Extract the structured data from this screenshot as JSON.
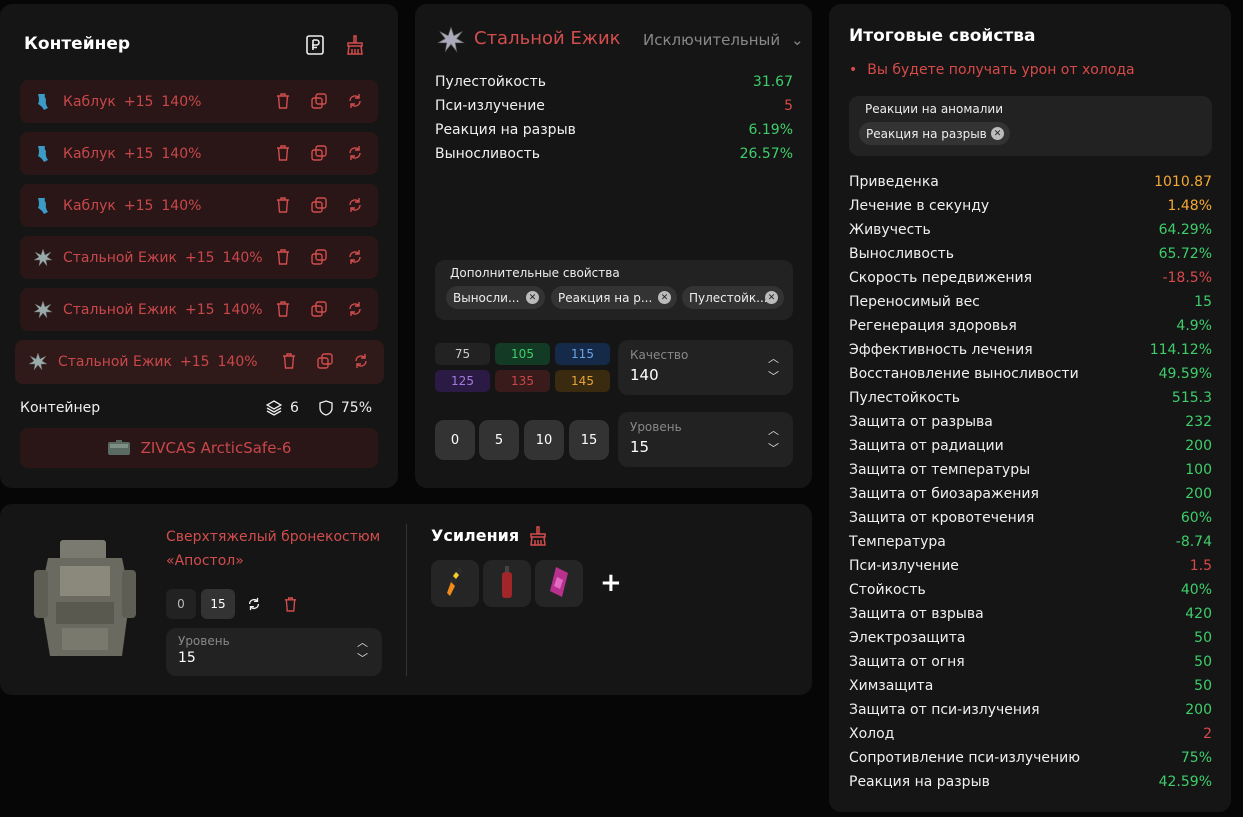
{
  "container": {
    "title": "Контейнер",
    "slots": [
      {
        "name": "Каблук",
        "level": "+15",
        "percent": "140%",
        "art": "kabluk"
      },
      {
        "name": "Каблук",
        "level": "+15",
        "percent": "140%",
        "art": "kabluk"
      },
      {
        "name": "Каблук",
        "level": "+15",
        "percent": "140%",
        "art": "kabluk"
      },
      {
        "name": "Стальной Ежик",
        "level": "+15",
        "percent": "140%",
        "art": "ezhik"
      },
      {
        "name": "Стальной Ежик",
        "level": "+15",
        "percent": "140%",
        "art": "ezhik"
      },
      {
        "name": "Стальной Ежик",
        "level": "+15",
        "percent": "140%",
        "art": "ezhik"
      }
    ],
    "footer_label": "Контейнер",
    "slot_count": "6",
    "protection": "75%",
    "container_name": "ZIVCAS ArcticSafe-6"
  },
  "item": {
    "name": "Стальной Ежик",
    "rarity": "Исключительный",
    "stats": [
      {
        "label": "Пулестойкость",
        "value": "31.67",
        "color": "g"
      },
      {
        "label": "Пси-излучение",
        "value": "5",
        "color": "r"
      },
      {
        "label": "Реакция на разрыв",
        "value": "6.19%",
        "color": "g"
      },
      {
        "label": "Выносливость",
        "value": "26.57%",
        "color": "g"
      }
    ],
    "extra_label": "Дополнительные свойства",
    "extra_chips": [
      "Выносли...",
      "Реакция на р...",
      "Пулестойк..."
    ],
    "quality_buttons": [
      "75",
      "105",
      "115",
      "125",
      "135",
      "145"
    ],
    "quality_label": "Качество",
    "quality_value": "140",
    "level_buttons": [
      "0",
      "5",
      "10",
      "15"
    ],
    "level_label": "Уровень",
    "level_value": "15"
  },
  "armor": {
    "name": "Сверхтяжелый бронекостюм «Апостол»",
    "level_min": "0",
    "level_cur": "15",
    "level_label": "Уровень",
    "level_value": "15",
    "boosts_title": "Усиления",
    "add_label": "+"
  },
  "totals": {
    "title": "Итоговые свойства",
    "warning": "Вы будете получать урон от холода",
    "anomaly_label": "Реакции на аномалии",
    "anomaly_chip": "Реакция на разрыв",
    "rows": [
      {
        "label": "Приведенка",
        "value": "1010.87",
        "color": "o"
      },
      {
        "label": "Лечение в секунду",
        "value": "1.48%",
        "color": "o"
      },
      {
        "label": "Живучесть",
        "value": "64.29%",
        "color": "g"
      },
      {
        "label": "Выносливость",
        "value": "65.72%",
        "color": "g"
      },
      {
        "label": "Скорость передвижения",
        "value": "-18.5%",
        "color": "r"
      },
      {
        "label": "Переносимый вес",
        "value": "15",
        "color": "g"
      },
      {
        "label": "Регенерация здоровья",
        "value": "4.9%",
        "color": "g"
      },
      {
        "label": "Эффективность лечения",
        "value": "114.12%",
        "color": "g"
      },
      {
        "label": "Восстановление выносливости",
        "value": "49.59%",
        "color": "g"
      },
      {
        "label": "Пулестойкость",
        "value": "515.3",
        "color": "g"
      },
      {
        "label": "Защита от разрыва",
        "value": "232",
        "color": "g"
      },
      {
        "label": "Защита от радиации",
        "value": "200",
        "color": "g"
      },
      {
        "label": "Защита от температуры",
        "value": "100",
        "color": "g"
      },
      {
        "label": "Защита от биозаражения",
        "value": "200",
        "color": "g"
      },
      {
        "label": "Защита от кровотечения",
        "value": "60%",
        "color": "g"
      },
      {
        "label": "Температура",
        "value": "-8.74",
        "color": "g"
      },
      {
        "label": "Пси-излучение",
        "value": "1.5",
        "color": "r"
      },
      {
        "label": "Стойкость",
        "value": "40%",
        "color": "g"
      },
      {
        "label": "Защита от взрыва",
        "value": "420",
        "color": "g"
      },
      {
        "label": "Электрозащита",
        "value": "50",
        "color": "g"
      },
      {
        "label": "Защита от огня",
        "value": "50",
        "color": "g"
      },
      {
        "label": "Химзащита",
        "value": "50",
        "color": "g"
      },
      {
        "label": "Защита от пси-излучения",
        "value": "200",
        "color": "g"
      },
      {
        "label": "Холод",
        "value": "2",
        "color": "r"
      },
      {
        "label": "Сопротивление пси-излучению",
        "value": "75%",
        "color": "g"
      },
      {
        "label": "Реакция на разрыв",
        "value": "42.59%",
        "color": "g"
      }
    ]
  },
  "colors": {
    "accent_red": "#d24d4d",
    "green": "#3fcd6b",
    "orange": "#f5a935",
    "panel": "#151515"
  }
}
